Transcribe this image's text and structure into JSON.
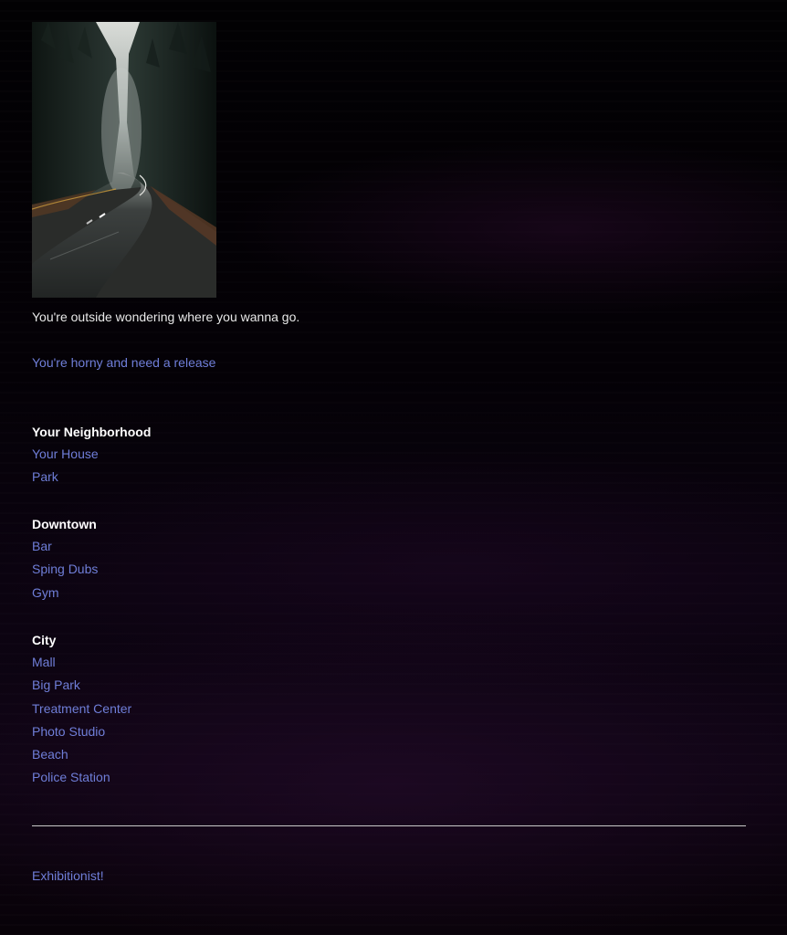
{
  "hero_image": {
    "alt_icon": "forest-road-photo"
  },
  "intro": {
    "text": "You're outside wondering where you wanna go."
  },
  "choice": {
    "label": "You're horny and need a release"
  },
  "sections": [
    {
      "heading": "Your Neighborhood",
      "items": [
        "Your House",
        "Park"
      ]
    },
    {
      "heading": "Downtown",
      "items": [
        "Bar",
        "Sping Dubs",
        "Gym"
      ]
    },
    {
      "heading": "City",
      "items": [
        "Mall",
        "Big Park",
        "Treatment Center",
        "Photo Studio",
        "Beach",
        "Police Station"
      ]
    }
  ],
  "footer": {
    "link_label": "Exhibitionist!"
  },
  "colors": {
    "link": "#6f7ed8",
    "text": "#e9e9e9",
    "heading": "#ffffff",
    "background": "#050107"
  }
}
